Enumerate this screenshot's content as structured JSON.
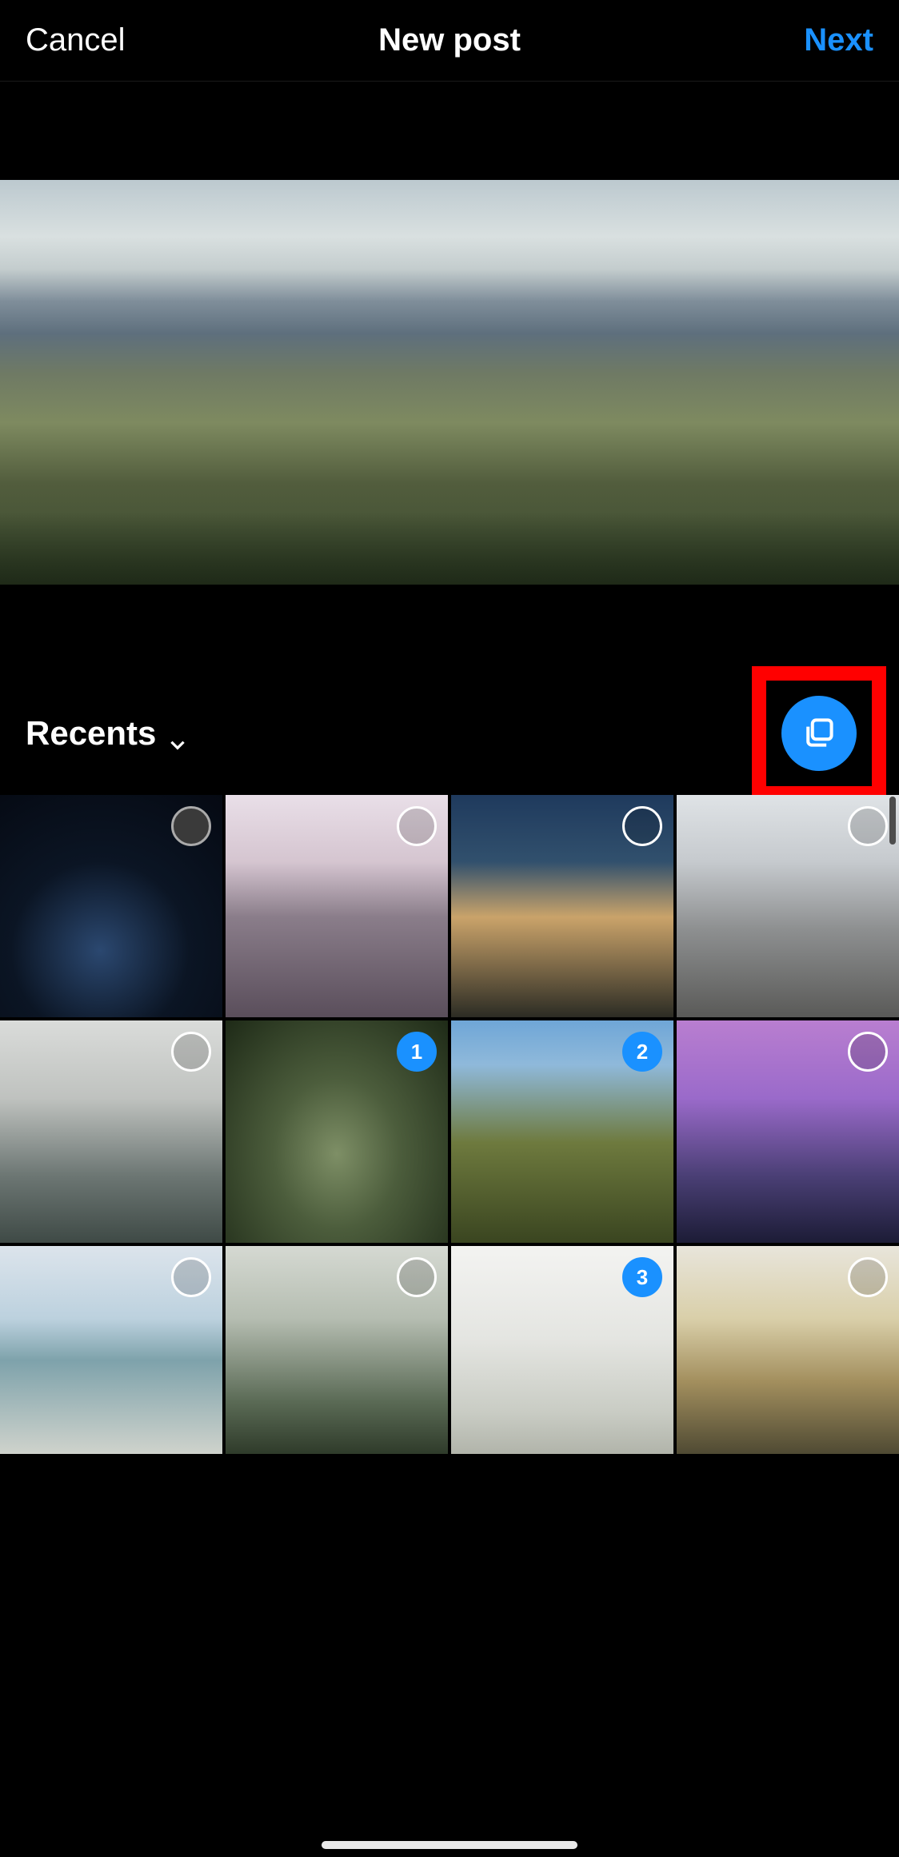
{
  "header": {
    "cancel_label": "Cancel",
    "title": "New post",
    "next_label": "Next",
    "next_color": "#1a91ff"
  },
  "album": {
    "label": "Recents"
  },
  "multi_select": {
    "active": true,
    "button_color": "#1a91ff",
    "highlight_color": "#ff0000",
    "icon": "stacked-squares-icon"
  },
  "grid": {
    "columns": 4,
    "items": [
      {
        "id": "t1",
        "palette": "g-night-city",
        "selected": false,
        "order": null,
        "is_current": true
      },
      {
        "id": "t2",
        "palette": "g-mountain-snow",
        "selected": false,
        "order": null,
        "is_current": false
      },
      {
        "id": "t3",
        "palette": "g-sunset-clouds",
        "selected": false,
        "order": null,
        "is_current": false
      },
      {
        "id": "t4",
        "palette": "g-city-aerial",
        "selected": false,
        "order": null,
        "is_current": false
      },
      {
        "id": "t5",
        "palette": "g-overcast-hills",
        "selected": false,
        "order": null,
        "is_current": false
      },
      {
        "id": "t6",
        "palette": "g-hairpin-road",
        "selected": true,
        "order": "1",
        "is_current": false
      },
      {
        "id": "t7",
        "palette": "g-hill-village",
        "selected": true,
        "order": "2",
        "is_current": false
      },
      {
        "id": "t8",
        "palette": "g-purple-dusk",
        "selected": false,
        "order": null,
        "is_current": false
      },
      {
        "id": "t9",
        "palette": "g-coast-city",
        "selected": false,
        "order": null,
        "is_current": false,
        "partial": true
      },
      {
        "id": "t10",
        "palette": "g-valley-haze",
        "selected": false,
        "order": null,
        "is_current": false,
        "partial": true
      },
      {
        "id": "t11",
        "palette": "g-white-mist",
        "selected": true,
        "order": "3",
        "is_current": false,
        "partial": true
      },
      {
        "id": "t12",
        "palette": "g-golden-town",
        "selected": false,
        "order": null,
        "is_current": false,
        "partial": true
      }
    ]
  }
}
